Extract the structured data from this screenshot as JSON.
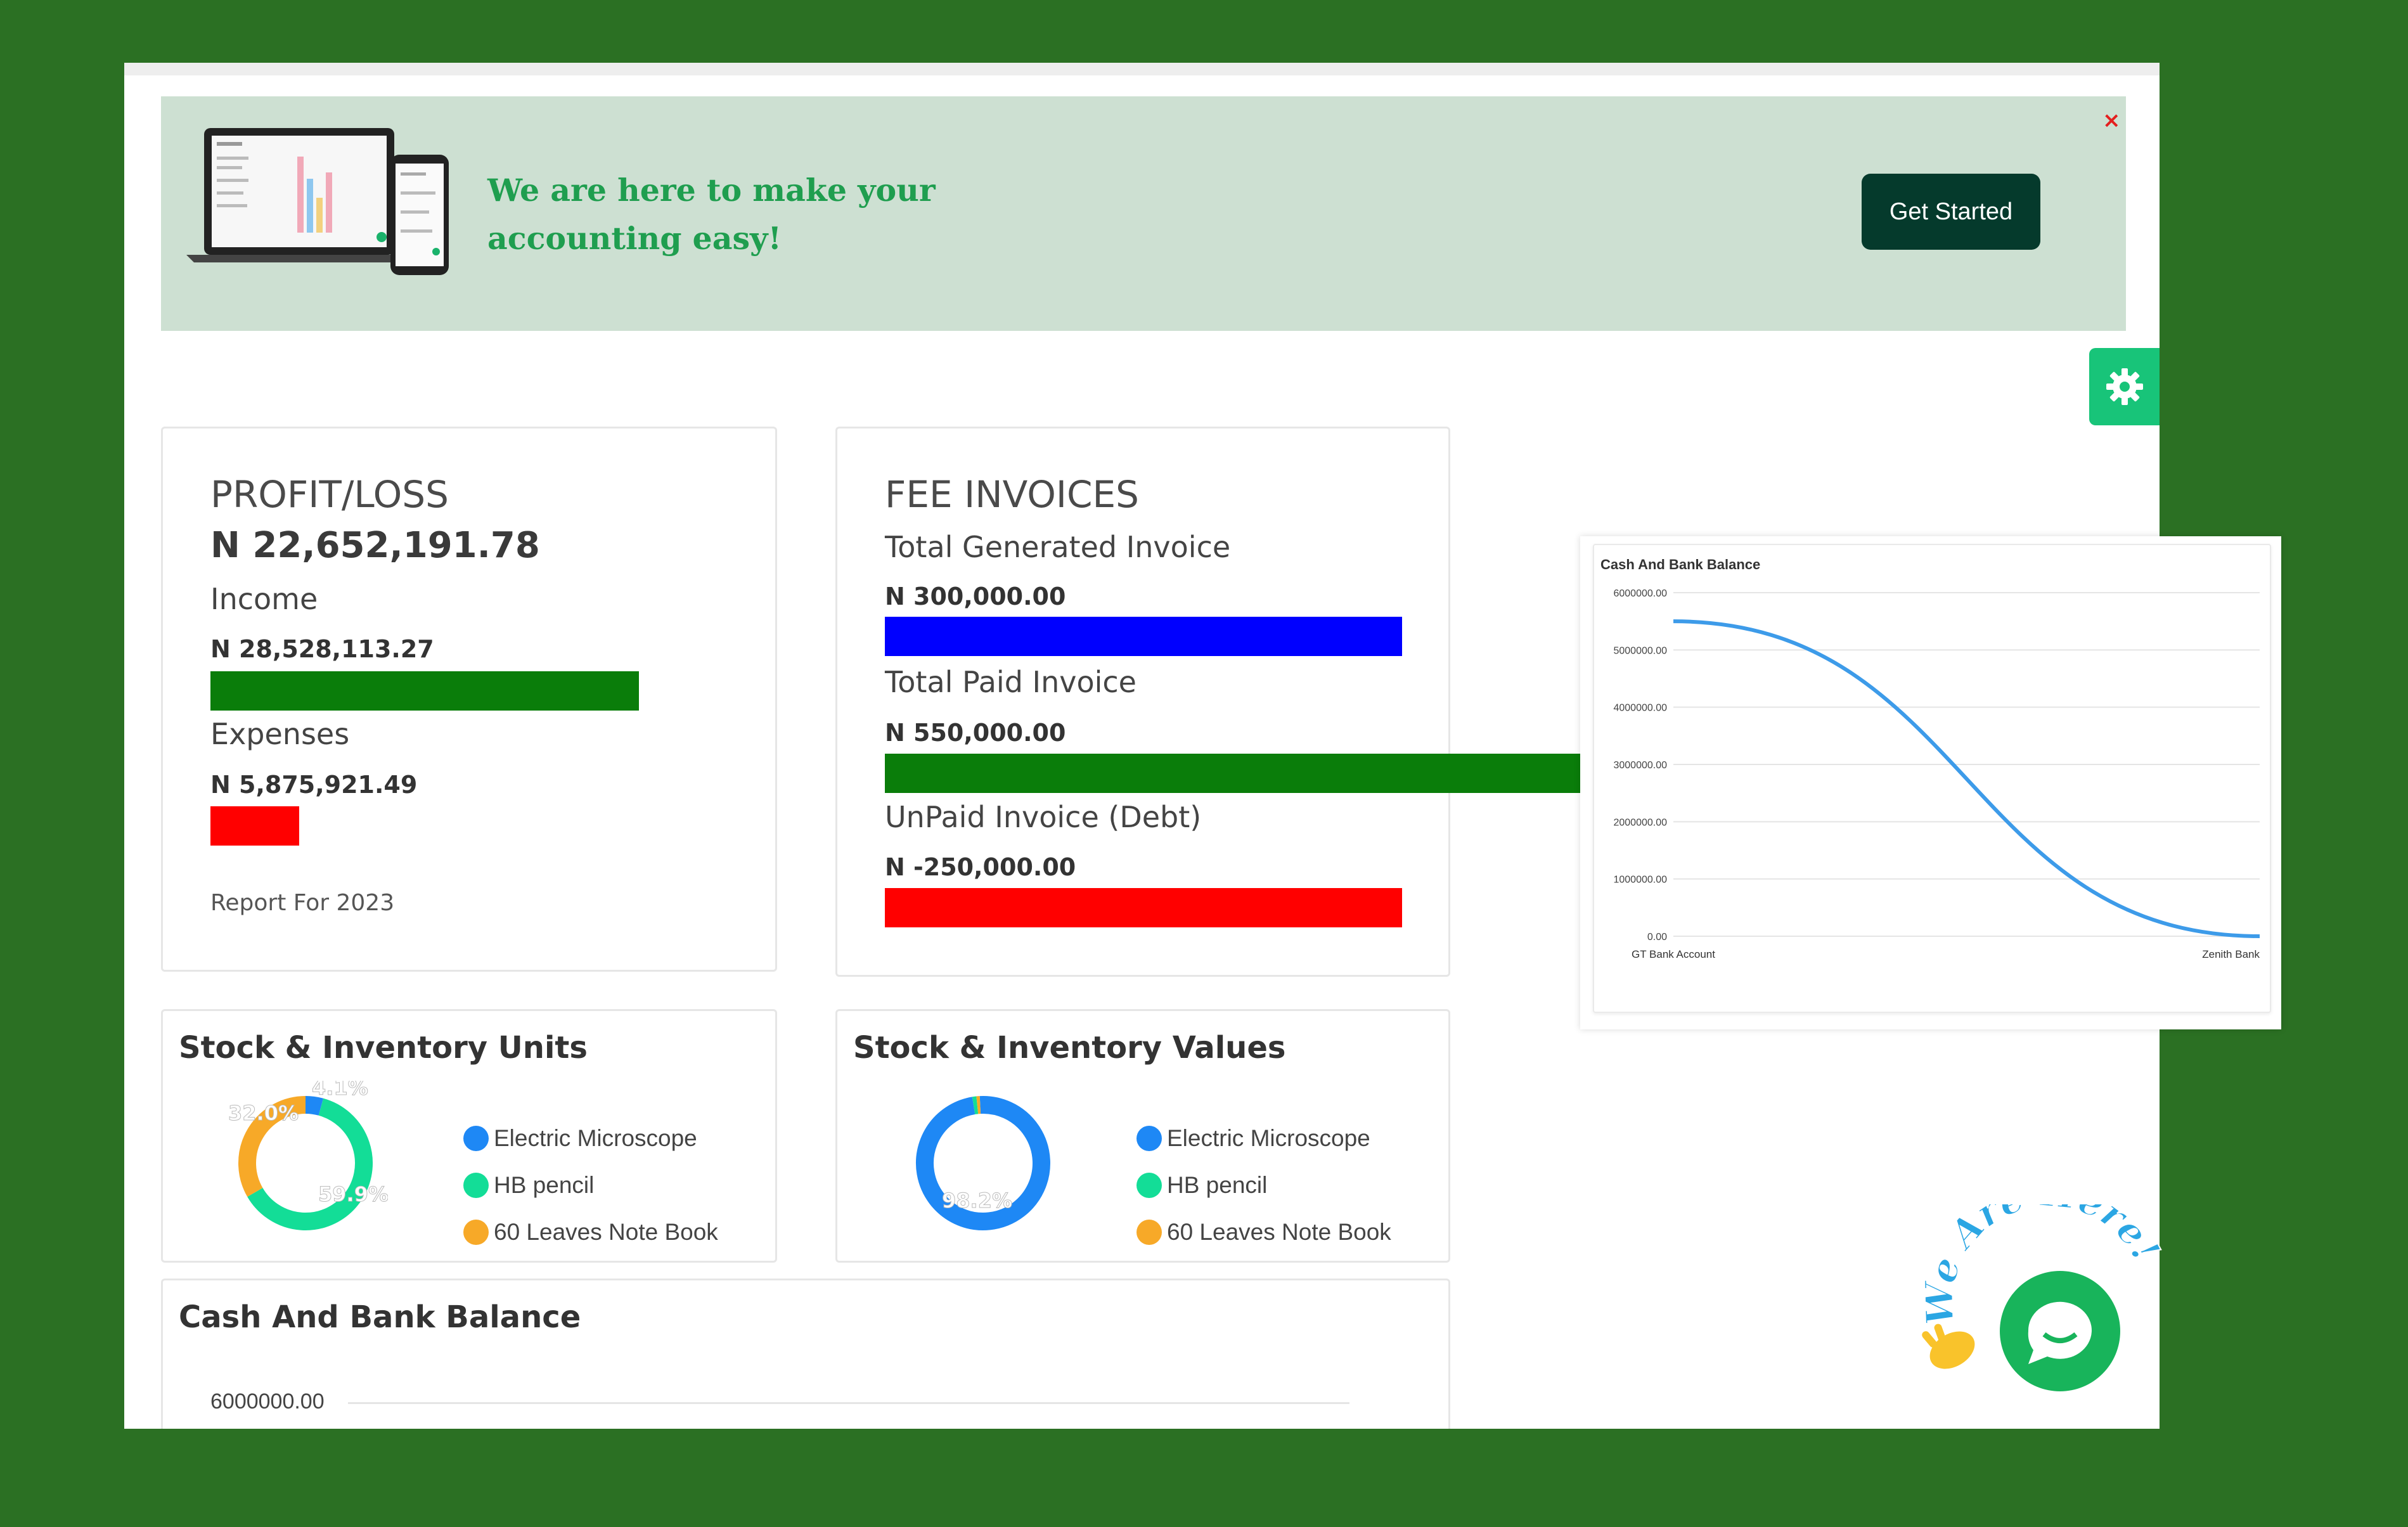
{
  "banner": {
    "message": "We are here to make your accounting easy!",
    "button_label": "Get Started",
    "close_label": "×"
  },
  "profit_loss": {
    "title": "PROFIT/LOSS",
    "value": "N 22,652,191.78",
    "income_label": "Income",
    "income_value": "N 28,528,113.27",
    "expenses_label": "Expenses",
    "expenses_value": "N 5,875,921.49",
    "report": "Report For 2023",
    "colors": {
      "income": "#0a7d0a",
      "expenses": "#ff0000"
    }
  },
  "fee_invoices": {
    "title": "FEE INVOICES",
    "generated_label": "Total Generated Invoice",
    "generated_value": "N 300,000.00",
    "paid_label": "Total Paid Invoice",
    "paid_value": "N 550,000.00",
    "unpaid_label": "UnPaid Invoice (Debt)",
    "unpaid_value": "N -250,000.00",
    "colors": {
      "generated": "#0000ff",
      "paid": "#0a7d0a",
      "unpaid": "#ff0000"
    }
  },
  "stock_units": {
    "title": "Stock & Inventory Units",
    "legend": [
      "Electric Microscope",
      "HB pencil",
      "60 Leaves Note Book"
    ],
    "slice_labels": [
      "4.1%",
      "59.9%",
      "32.0%"
    ]
  },
  "stock_values": {
    "title": "Stock & Inventory Values",
    "legend": [
      "Electric Microscope",
      "HB pencil",
      "60 Leaves Note Book"
    ],
    "slice_labels": [
      "98.2%"
    ]
  },
  "cash_bank_card": {
    "title": "Cash And Bank Balance",
    "first_tick": "6000000.00"
  },
  "chart_data": [
    {
      "type": "pie",
      "title": "Stock & Inventory Units",
      "categories": [
        "Electric Microscope",
        "HB pencil",
        "60 Leaves Note Book"
      ],
      "values": [
        4.1,
        59.9,
        32.0
      ],
      "colors": [
        "#1e88f5",
        "#13dd97",
        "#f7a928"
      ],
      "legend_position": "right"
    },
    {
      "type": "pie",
      "title": "Stock & Inventory Values",
      "categories": [
        "Electric Microscope",
        "HB pencil",
        "60 Leaves Note Book"
      ],
      "values": [
        98.2,
        1.0,
        0.8
      ],
      "colors": [
        "#1e88f5",
        "#13dd97",
        "#f7a928"
      ],
      "legend_position": "right"
    },
    {
      "type": "line",
      "title": "Cash And Bank Balance",
      "categories": [
        "GT Bank Account",
        "Zenith Bank"
      ],
      "values": [
        5500000,
        0
      ],
      "yticks": [
        "6000000.00",
        "5000000.00",
        "4000000.00",
        "3000000.00",
        "2000000.00",
        "1000000.00",
        "0.00"
      ],
      "ylim": [
        0,
        6000000
      ],
      "grid": true,
      "color": "#3d9be9"
    }
  ],
  "chat": {
    "text": "We Are Here!"
  }
}
